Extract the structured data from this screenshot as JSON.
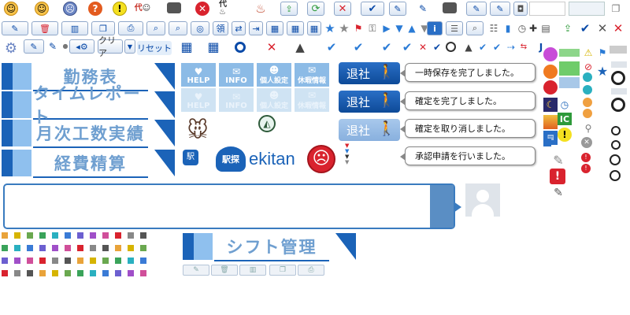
{
  "nav": {
    "items": [
      {
        "label": "勤務表"
      },
      {
        "label": "タイムレポート"
      },
      {
        "label": "月次工数実績"
      },
      {
        "label": "経費精算"
      }
    ],
    "shift_label": "シフト管理"
  },
  "help_buttons": {
    "items": [
      {
        "label": "HELP"
      },
      {
        "label": "INFO"
      },
      {
        "label": "個人設定"
      },
      {
        "label": "休暇情報"
      }
    ]
  },
  "leave_buttons": {
    "label": "退社"
  },
  "messages": {
    "items": [
      {
        "text": "一時保存を完了しました。"
      },
      {
        "text": "確定を完了しました。"
      },
      {
        "text": "確定を取り消しました。"
      },
      {
        "text": "承認申請を行いました。"
      }
    ]
  },
  "toolbar": {
    "clear_label": "クリア",
    "reset_label": "リセット",
    "kanji_label": "代",
    "ic_label": "IC",
    "info_label": "i"
  },
  "brand": {
    "ekitan": "ekitan"
  },
  "colors": {
    "primary": "#1b63b8",
    "light_blue": "#8fc0ee",
    "error_red": "#d9232e",
    "ok_green": "#2e9a3a"
  }
}
